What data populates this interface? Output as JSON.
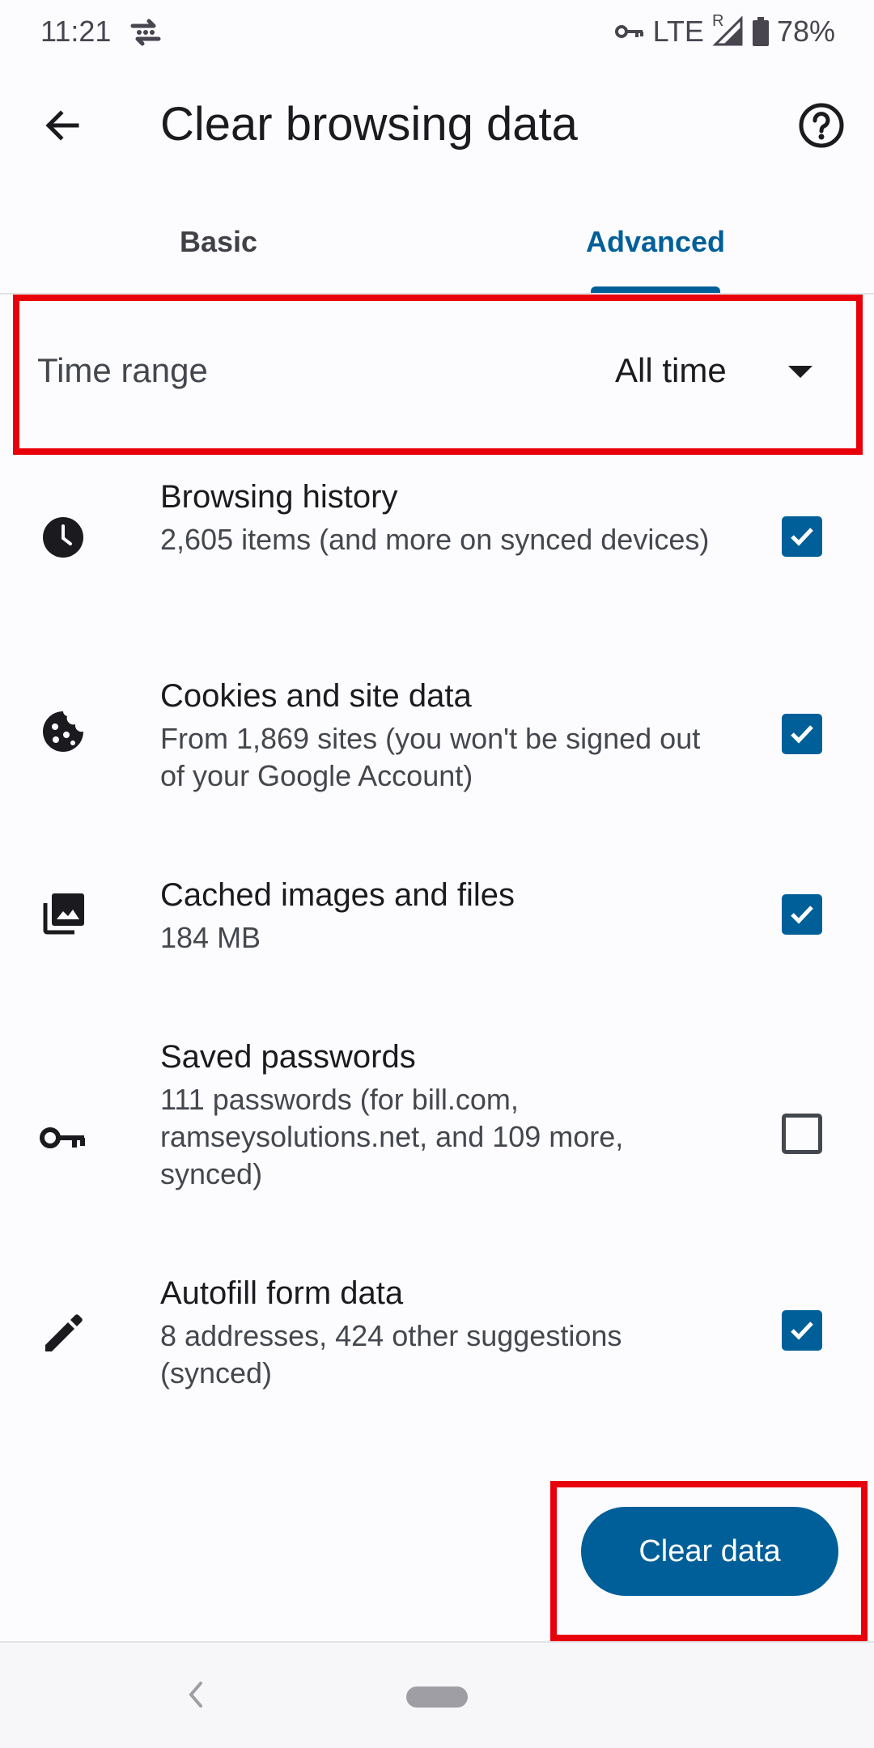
{
  "status_bar": {
    "time": "11:21",
    "network": "LTE",
    "roaming": "R",
    "battery": "78%"
  },
  "app_bar": {
    "title": "Clear browsing data"
  },
  "tabs": [
    {
      "label": "Basic",
      "selected": false
    },
    {
      "label": "Advanced",
      "selected": true
    }
  ],
  "time_range": {
    "label": "Time range",
    "value": "All time"
  },
  "options": [
    {
      "title": "Browsing history",
      "subtitle": "2,605 items (and more on synced devices)",
      "icon": "clock-icon",
      "checked": true
    },
    {
      "title": "Cookies and site data",
      "subtitle": "From 1,869 sites (you won't be signed out of your Google Account)",
      "icon": "cookie-icon",
      "checked": true
    },
    {
      "title": "Cached images and files",
      "subtitle": "184 MB",
      "icon": "images-icon",
      "checked": true
    },
    {
      "title": "Saved passwords",
      "subtitle": "111 passwords (for bill.com, ramseysolutions.net, and 109 more, synced)",
      "icon": "key-icon",
      "checked": false
    },
    {
      "title": "Autofill form data",
      "subtitle": "8 addresses, 424 other suggestions (synced)",
      "icon": "pencil-icon",
      "checked": true
    }
  ],
  "actions": {
    "clear_label": "Clear data"
  },
  "colors": {
    "accent": "#005f98",
    "highlight": "#e8000b",
    "background": "#fcfcff"
  }
}
